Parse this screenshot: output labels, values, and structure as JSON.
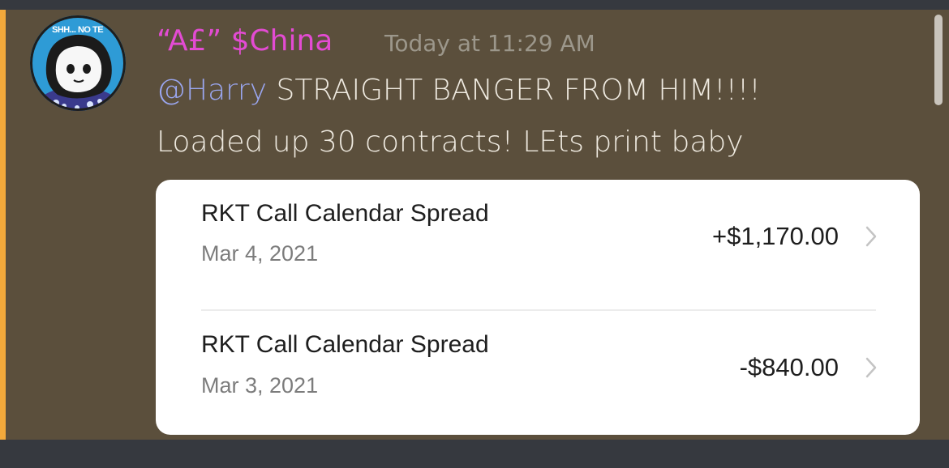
{
  "message": {
    "username": "“A£” $China",
    "timestamp": "Today at 11:29 AM",
    "avatar_text": "SHH... NO TE",
    "mention": "@Harry",
    "line1_text": " STRAIGHT BANGER FROM HIM!!!!",
    "line2_text": "Loaded up 30 contracts! LEts print baby"
  },
  "embed": {
    "trades": [
      {
        "title": "RKT Call Calendar Spread",
        "date": "Mar 4, 2021",
        "amount": "+$1,170.00"
      },
      {
        "title": "RKT Call Calendar Spread",
        "date": "Mar 3, 2021",
        "amount": "-$840.00"
      }
    ]
  },
  "colors": {
    "username": "#e34bd3",
    "mention": "#9aa6ef",
    "highlight_background": "#5b4f3c",
    "mention_bar": "#f2a93b"
  },
  "icons": {
    "row_chevron": "chevron-right-icon"
  }
}
